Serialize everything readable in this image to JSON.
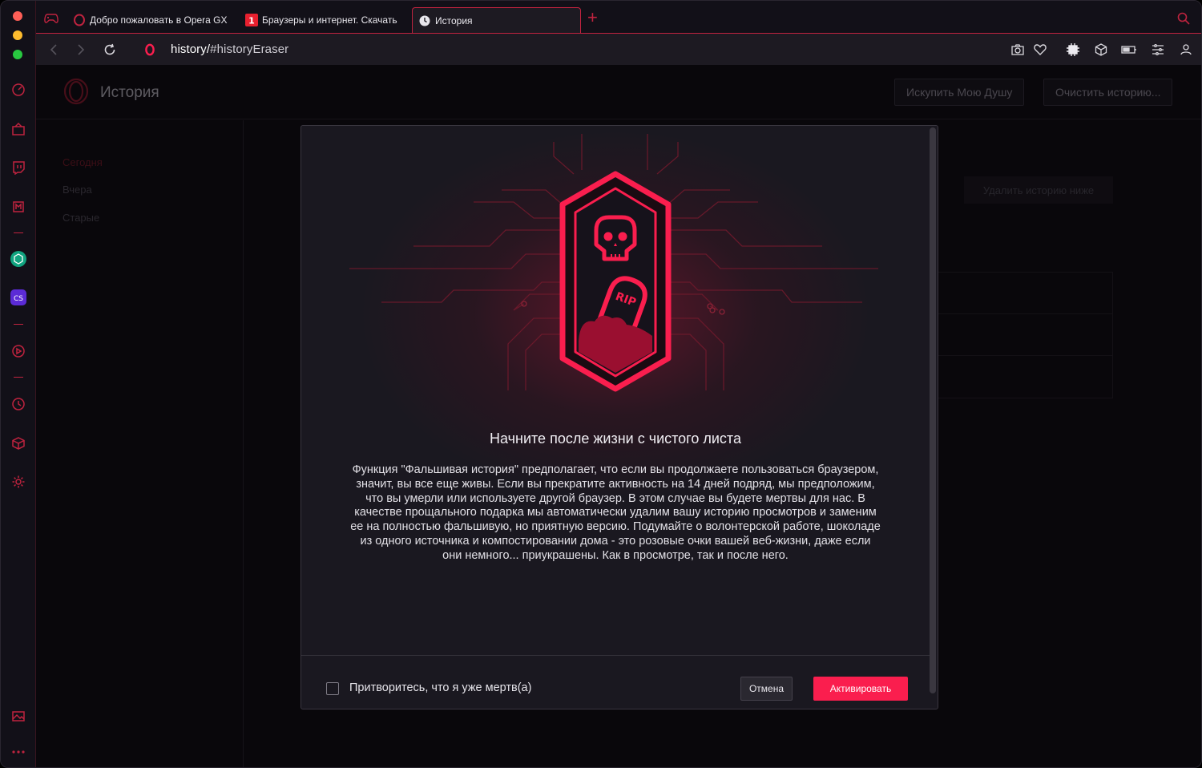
{
  "colors": {
    "accent": "#fa1e4e",
    "accent_dark": "#c0233f",
    "background": "#0b0a0e",
    "panel": "#1a1820"
  },
  "tabs": [
    {
      "label": "Добро пожаловать в Opera GX",
      "icon": "opera-icon"
    },
    {
      "label": "Браузеры и интернет. Скачать",
      "icon": "site-favicon"
    },
    {
      "label": "История",
      "icon": "clock-icon",
      "active": true
    }
  ],
  "address": {
    "host": "history/",
    "path": "#historyEraser"
  },
  "page": {
    "title": "История",
    "buttons": {
      "redeem": "Искупить Мою Душу",
      "clear": "Очистить историю..."
    },
    "nav": [
      "Сегодня",
      "Вчера",
      "Старые"
    ],
    "delete_below": "Удалить историю ниже"
  },
  "modal": {
    "badge_text": "RIP",
    "heading": "Начните после жизни с чистого листа",
    "body": "Функция \"Фальшивая история\" предполагает, что если вы продолжаете пользоваться браузером, значит, вы все еще живы. Если вы прекратите активность на 14 дней подряд, мы предположим, что вы умерли или используете другой браузер. В этом случае вы будете мертвы для нас. В качестве прощального подарка мы автоматически удалим вашу историю просмотров и заменим ее на полностью фальшивую, но приятную версию. Подумайте о волонтерской работе, шоколаде из одного источника и компостировании дома - это розовые очки вашей веб-жизни, даже если они немного... приукрашены. Как в просмотре, так и после него.",
    "checkbox_label": "Притворитесь, что я уже мертв(а)",
    "cancel": "Отмена",
    "activate": "Активировать"
  }
}
